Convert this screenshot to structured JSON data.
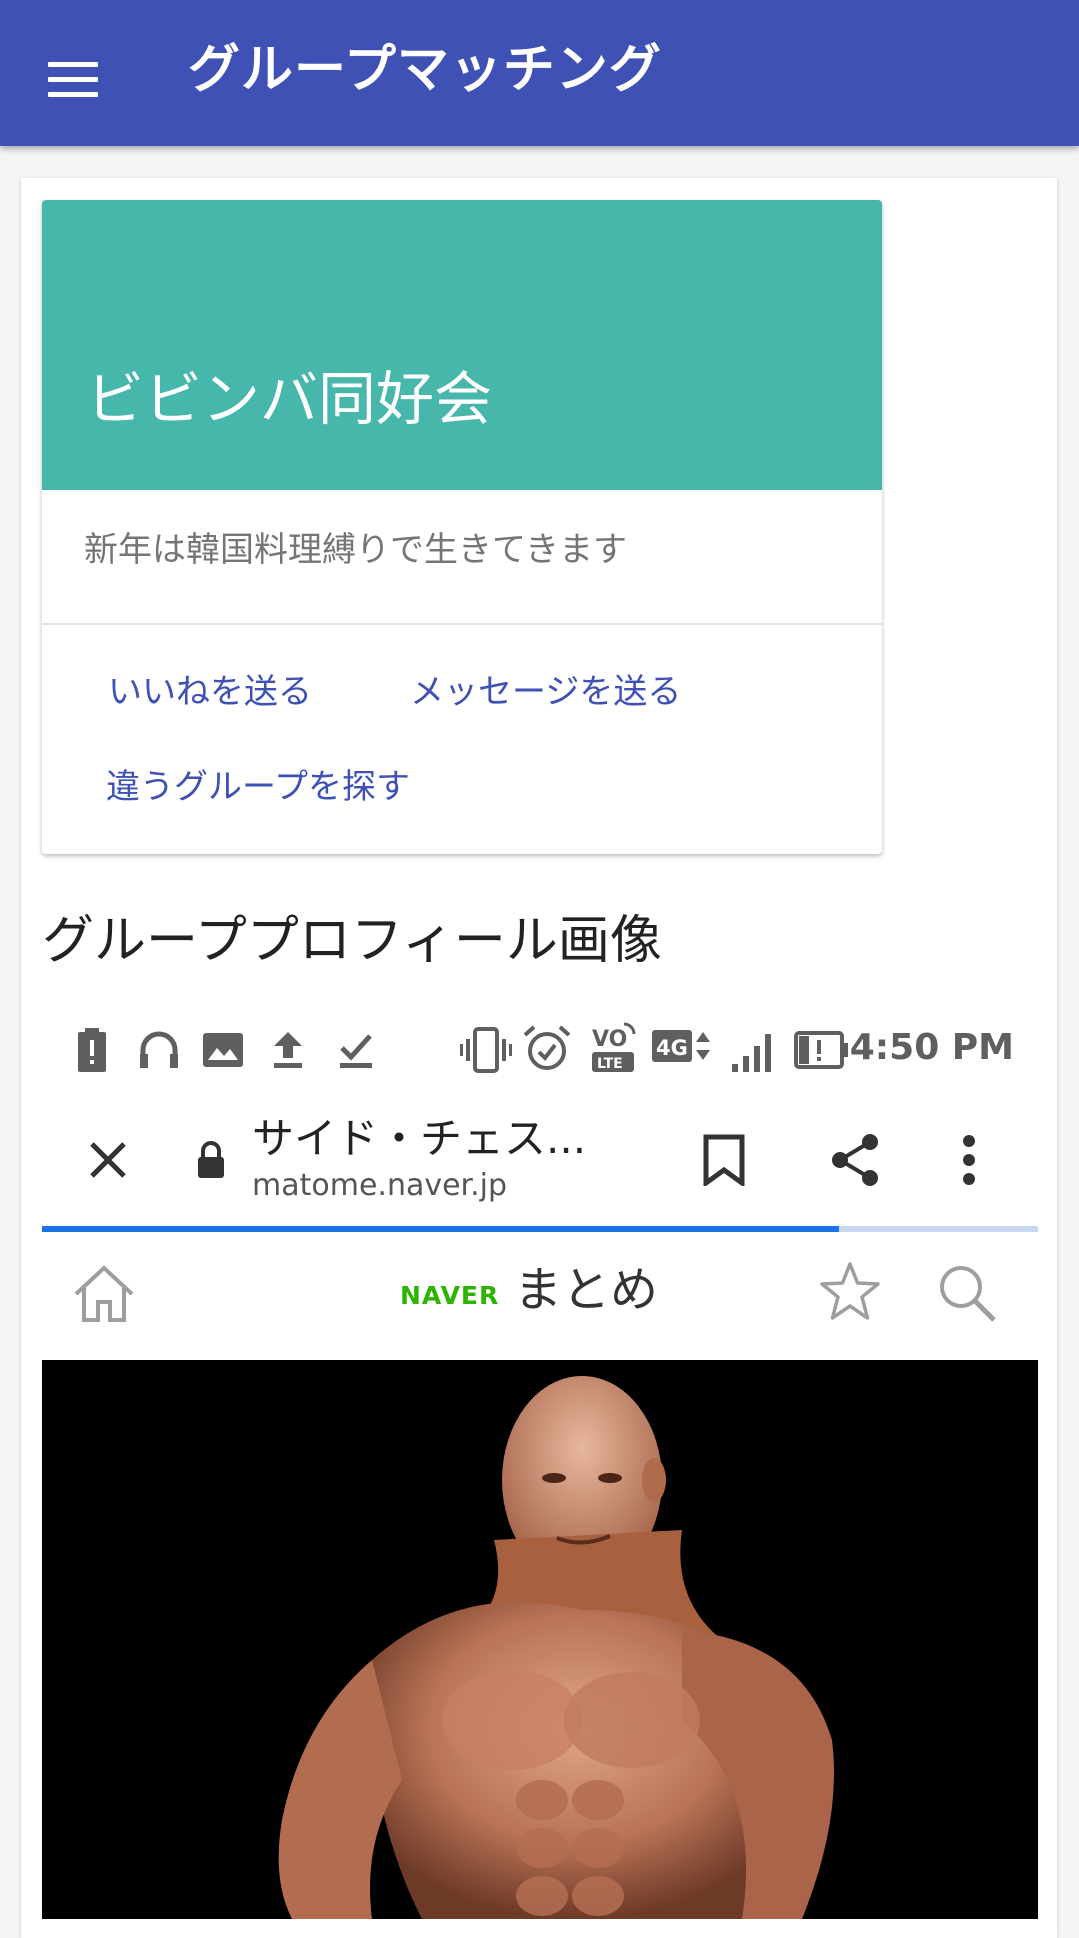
{
  "appbar": {
    "title": "グループマッチング",
    "menu_icon": "hamburger-menu-icon"
  },
  "card": {
    "header_color": "#47b6ab",
    "title": "ビビンバ同好会",
    "description": "新年は韓国料理縛りで生きてきます",
    "actions": [
      "いいねを送る",
      "メッセージを送る",
      "違うグループを探す"
    ]
  },
  "section": {
    "title": "グループプロフィール画像"
  },
  "screenshot": {
    "status_bar": {
      "time": "4:50 PM",
      "network": "4G",
      "volte": "VO LTE"
    },
    "browser": {
      "page_title": "サイド・チェス...",
      "url": "matome.naver.jp",
      "load_progress": 0.8
    },
    "naver": {
      "brand": "NAVER",
      "service": "まとめ"
    },
    "photo_description_icon": "bodybuilder-photo"
  },
  "colors": {
    "primary": "#3f51b5",
    "accent": "#47b6ab",
    "naver_green": "#2db400",
    "progress_blue": "#1a73e8"
  }
}
